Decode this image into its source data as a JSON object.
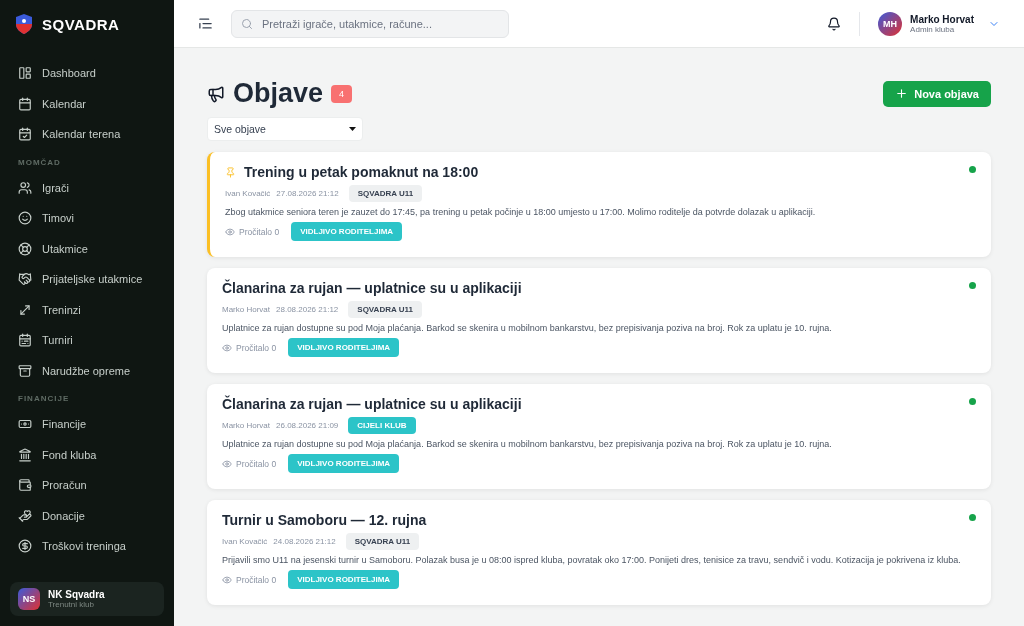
{
  "brand": {
    "name": "SQVADRA"
  },
  "sidebar": {
    "sections": [
      {
        "items": [
          {
            "label": "Dashboard",
            "selected": false
          },
          {
            "label": "Kalendar",
            "selected": false
          },
          {
            "label": "Kalendar terena",
            "selected": false
          }
        ]
      },
      {
        "title": "MOMČAD",
        "items": [
          {
            "label": "Igrači",
            "selected": false
          },
          {
            "label": "Timovi",
            "selected": false
          },
          {
            "label": "Utakmice",
            "selected": false
          },
          {
            "label": "Prijateljske utakmice",
            "selected": false
          },
          {
            "label": "Treninzi",
            "selected": false
          },
          {
            "label": "Turniri",
            "selected": false
          },
          {
            "label": "Narudžbe opreme",
            "selected": false
          }
        ]
      },
      {
        "title": "FINANCIJE",
        "items": [
          {
            "label": "Financije",
            "selected": false
          },
          {
            "label": "Fond kluba",
            "selected": false
          },
          {
            "label": "Proračun",
            "selected": false
          },
          {
            "label": "Donacije",
            "selected": false
          },
          {
            "label": "Troškovi treninga",
            "selected": false
          }
        ]
      }
    ],
    "club": {
      "initials": "NS",
      "name": "NK Sqvadra",
      "subtitle": "Trenutni klub"
    }
  },
  "topbar": {
    "search": {
      "placeholder": "Pretraži igrače, utakmice, račune..."
    },
    "user": {
      "initials": "MH",
      "name": "Marko Horvat",
      "role": "Admin kluba"
    }
  },
  "page": {
    "title": "Objave",
    "count": "4",
    "new_button": "Nova objava",
    "filter": "Sve objave"
  },
  "posts": [
    {
      "title": "Trening u petak pomaknut na 18:00",
      "pinned": true,
      "author": "Ivan Kovačić",
      "date": "27.08.2026 21:12",
      "audience": {
        "kind": "team",
        "label": "SQVADRA U11"
      },
      "body": "Zbog utakmice seniora teren je zauzet do 17:45, pa trening u petak počinje u 18:00 umjesto u 17:00. Molimo roditelje da potvrde dolazak u aplikaciji.",
      "read": "Pročitalo 0",
      "visibility": "VIDLJIVO RODITELJIMA",
      "color": "#16a34a"
    },
    {
      "title": "Članarina za rujan — uplatnice su u aplikaciji",
      "pinned": false,
      "author": "Marko Horvat",
      "date": "28.08.2026 21:12",
      "audience": {
        "kind": "team",
        "label": "SQVADRA U11"
      },
      "body": "Uplatnice za rujan dostupne su pod Moja plaćanja. Barkod se skenira u mobilnom bankarstvu, bez prepisivanja poziva na broj. Rok za uplatu je 10. rujna.",
      "read": "Pročitalo 0",
      "visibility": "VIDLJIVO RODITELJIMA",
      "color": "#16a34a"
    },
    {
      "title": "Članarina za rujan — uplatnice su u aplikaciji",
      "pinned": false,
      "author": "Marko Horvat",
      "date": "26.08.2026 21:09",
      "audience": {
        "kind": "club",
        "label": "CIJELI KLUB"
      },
      "body": "Uplatnice za rujan dostupne su pod Moja plaćanja. Barkod se skenira u mobilnom bankarstvu, bez prepisivanja poziva na broj. Rok za uplatu je 10. rujna.",
      "read": "Pročitalo 0",
      "visibility": "VIDLJIVO RODITELJIMA",
      "color": "#16a34a"
    },
    {
      "title": "Turnir u Samoboru — 12. rujna",
      "pinned": false,
      "author": "Ivan Kovačić",
      "date": "24.08.2026 21:12",
      "audience": {
        "kind": "team",
        "label": "SQVADRA U11"
      },
      "body": "Prijavili smo U11 na jesenski turnir u Samoboru. Polazak busa je u 08:00 ispred kluba, povratak oko 17:00. Ponijeti dres, tenisice za travu, sendvič i vodu. Kotizacija je pokrivena iz kluba.",
      "read": "Pročitalo 0",
      "visibility": "VIDLJIVO RODITELJIMA",
      "color": "#16a34a"
    }
  ]
}
